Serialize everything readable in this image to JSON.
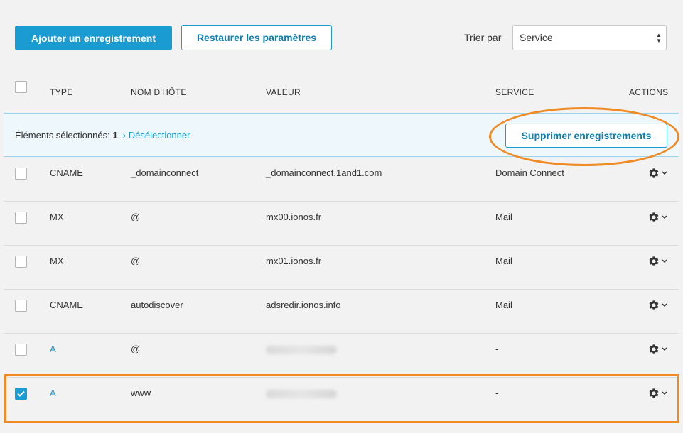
{
  "toolbar": {
    "add_label": "Ajouter un enregistrement",
    "restore_label": "Restaurer les paramètres",
    "sort_label": "Trier par",
    "sort_value": "Service"
  },
  "table": {
    "headers": {
      "type": "TYPE",
      "hostname": "NOM D'HÔTE",
      "value": "VALEUR",
      "service": "SERVICE",
      "actions": "ACTIONS"
    }
  },
  "selection": {
    "label": "Éléments sélectionnés:",
    "count": "1",
    "deselect": "Désélectionner",
    "delete_label": "Supprimer enregistrements"
  },
  "rows": [
    {
      "type": "CNAME",
      "host": "_domainconnect",
      "value": "_domainconnect.1and1.com",
      "service": "Domain Connect",
      "checked": false,
      "type_link": false
    },
    {
      "type": "MX",
      "host": "@",
      "value": "mx00.ionos.fr",
      "service": "Mail",
      "checked": false,
      "type_link": false
    },
    {
      "type": "MX",
      "host": "@",
      "value": "mx01.ionos.fr",
      "service": "Mail",
      "checked": false,
      "type_link": false
    },
    {
      "type": "CNAME",
      "host": "autodiscover",
      "value": "adsredir.ionos.info",
      "service": "Mail",
      "checked": false,
      "type_link": false
    },
    {
      "type": "A",
      "host": "@",
      "value": "",
      "service": "-",
      "checked": false,
      "type_link": true
    },
    {
      "type": "A",
      "host": "www",
      "value": "",
      "service": "-",
      "checked": true,
      "type_link": true
    }
  ],
  "colors": {
    "accent": "#1a9bd1",
    "highlight": "#f08a24"
  }
}
